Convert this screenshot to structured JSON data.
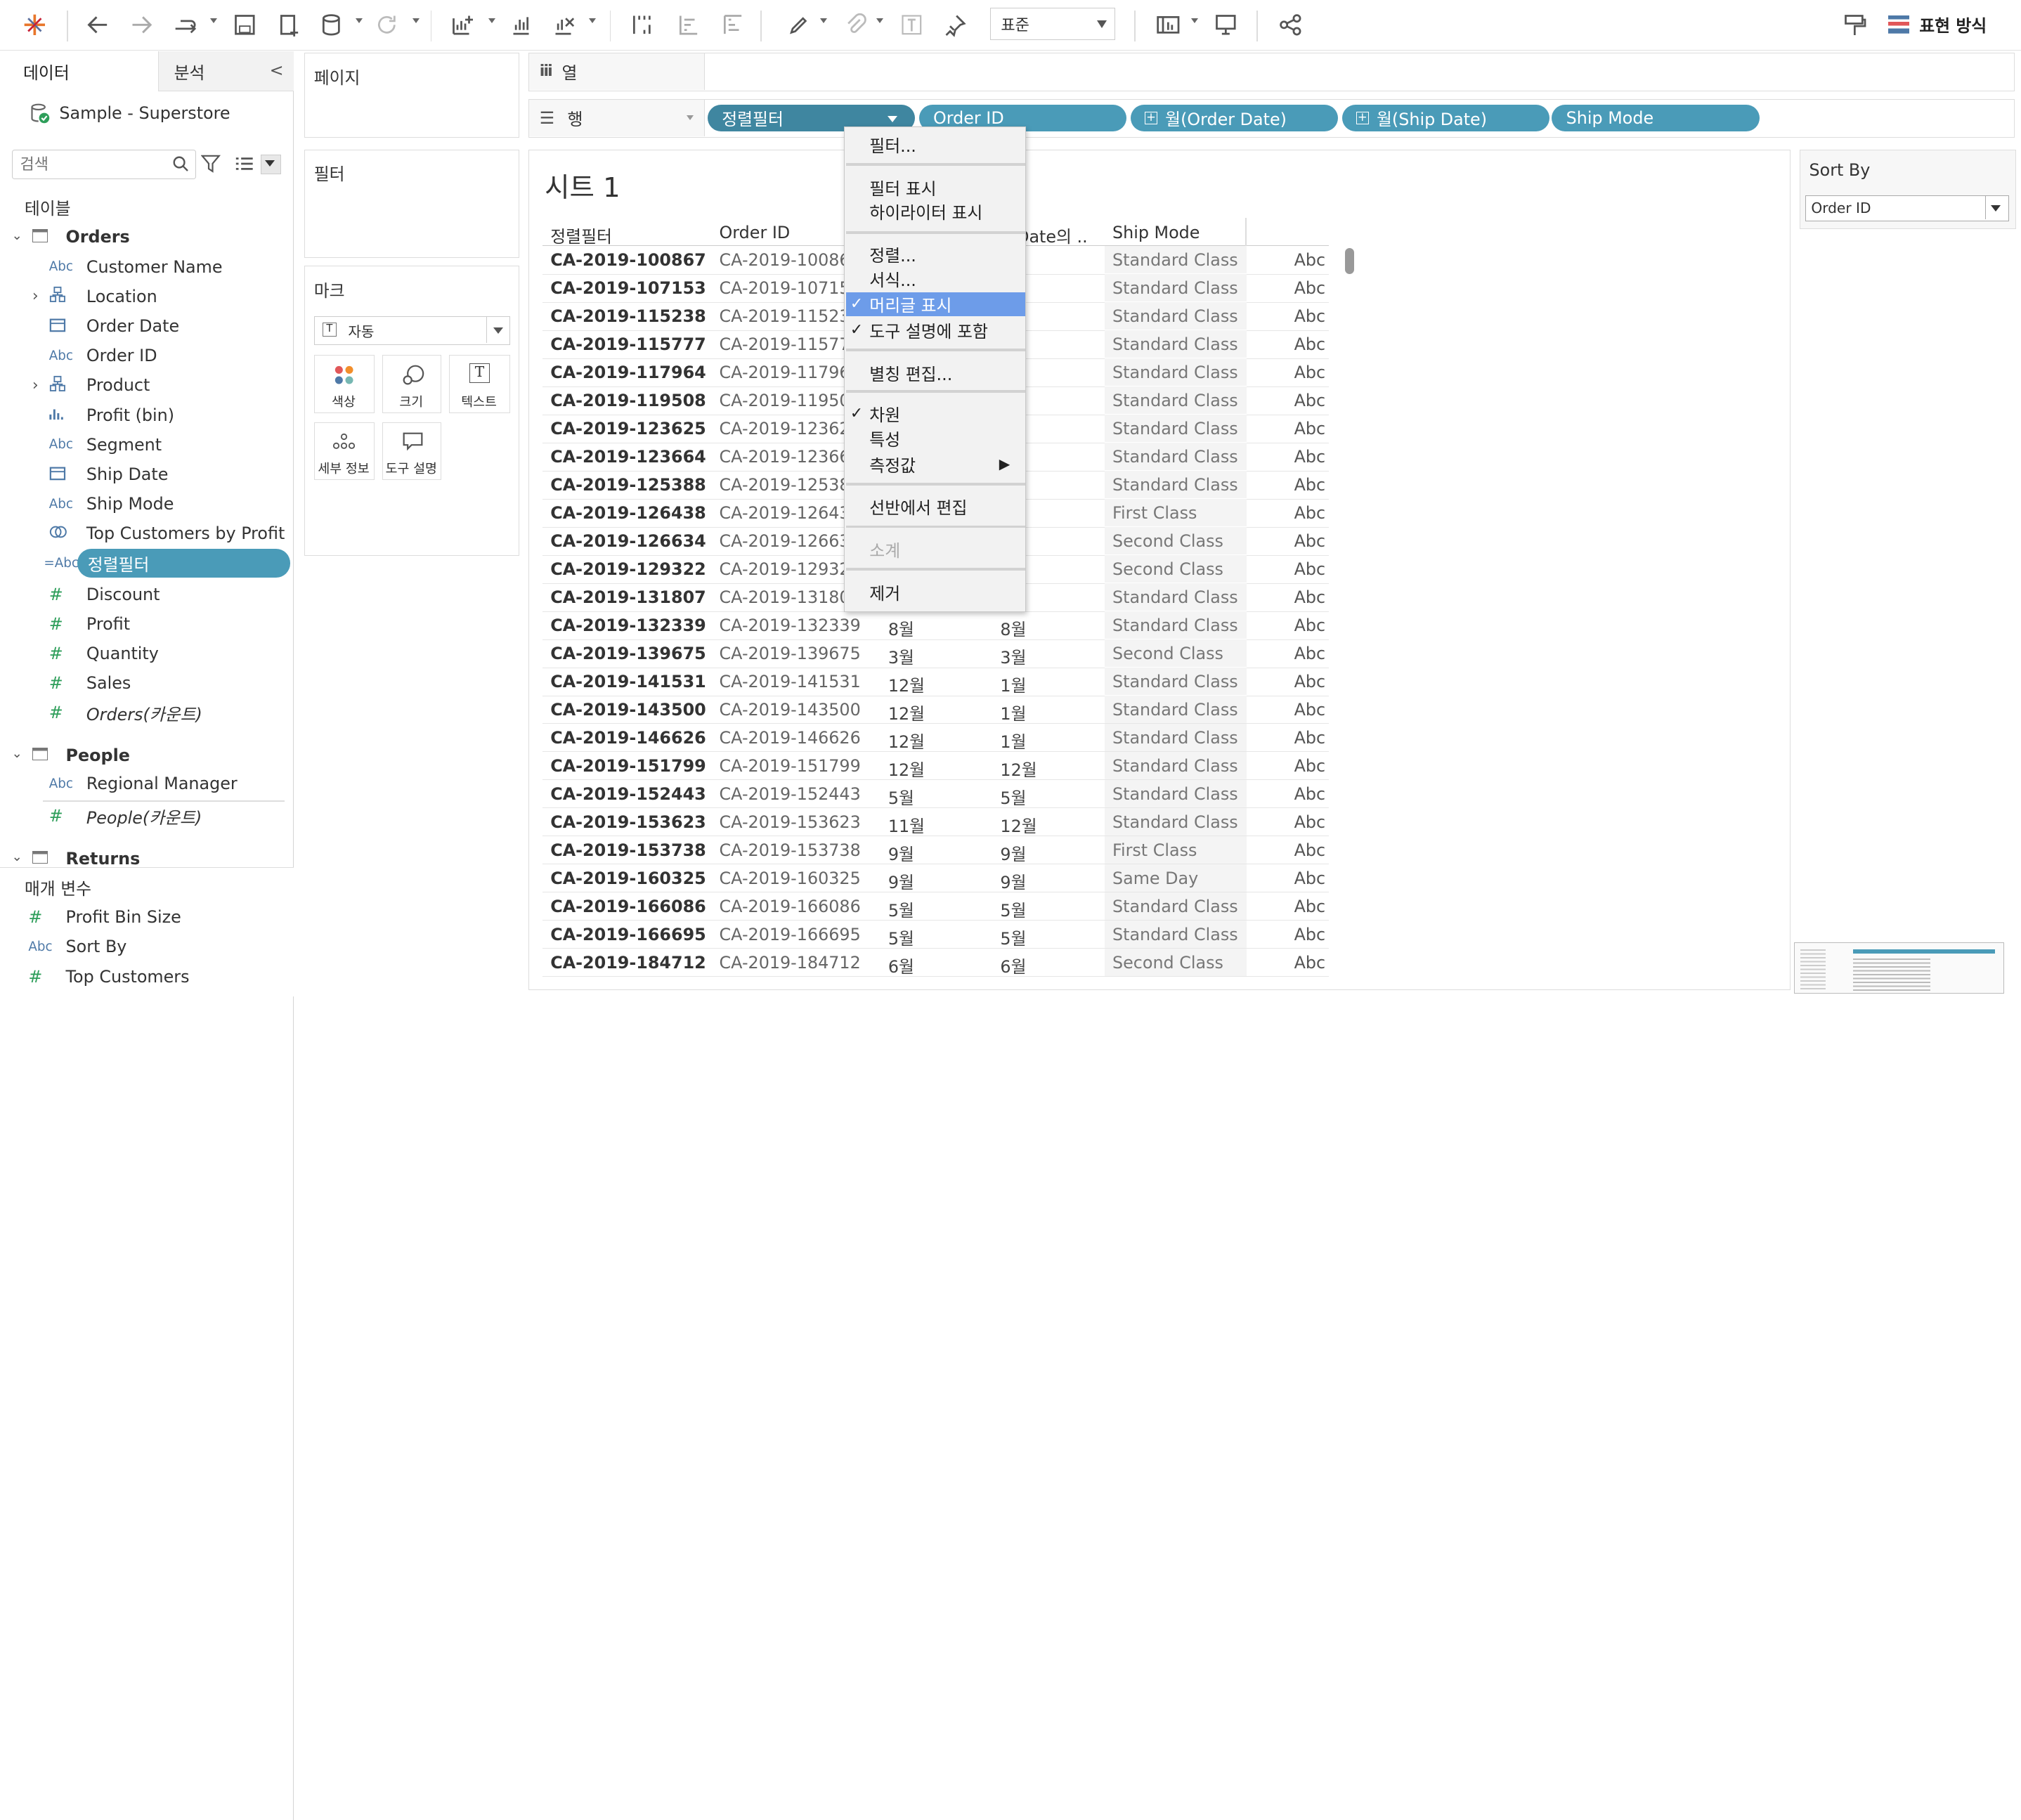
{
  "toolbar": {
    "view_mode": "표준",
    "show_me_label": "표현 방식"
  },
  "datapane": {
    "tab_data": "데이터",
    "tab_analytics": "분석",
    "datasource": "Sample - Superstore",
    "search_placeholder": "검색",
    "tables_header": "테이블",
    "orders_table": "Orders",
    "orders_fields": [
      {
        "type": "Abc",
        "name": "Customer Name"
      },
      {
        "type": "hier",
        "name": "Location"
      },
      {
        "type": "date",
        "name": "Order Date"
      },
      {
        "type": "Abc",
        "name": "Order ID"
      },
      {
        "type": "hier",
        "name": "Product"
      },
      {
        "type": "bin",
        "name": "Profit (bin)"
      },
      {
        "type": "Abc",
        "name": "Segment"
      },
      {
        "type": "date",
        "name": "Ship Date"
      },
      {
        "type": "Abc",
        "name": "Ship Mode"
      },
      {
        "type": "set",
        "name": "Top Customers by Profit"
      },
      {
        "type": "=Abc",
        "name": "정렬필터"
      },
      {
        "type": "#",
        "name": "Discount"
      },
      {
        "type": "#",
        "name": "Profit"
      },
      {
        "type": "#",
        "name": "Quantity"
      },
      {
        "type": "#",
        "name": "Sales"
      },
      {
        "type": "#",
        "name": "Orders(카운트)"
      }
    ],
    "people_table": "People",
    "people_fields": [
      {
        "type": "Abc",
        "name": "Regional Manager"
      },
      {
        "type": "#",
        "name": "People(카운트)"
      }
    ],
    "returns_table": "Returns",
    "params_header": "매개 변수",
    "params": [
      {
        "type": "#",
        "name": "Profit Bin Size"
      },
      {
        "type": "Abc",
        "name": "Sort By"
      },
      {
        "type": "#",
        "name": "Top Customers"
      }
    ]
  },
  "cards": {
    "pages": "페이지",
    "filters": "필터",
    "marks": "마크",
    "mark_type": "자동",
    "mark_buttons": [
      "색상",
      "크기",
      "텍스트",
      "세부 정보",
      "도구 설명"
    ]
  },
  "shelves": {
    "columns_label": "열",
    "rows_label": "행",
    "row_pills": [
      "정렬필터",
      "Order ID",
      "월(Order Date)",
      "월(Ship Date)",
      "Ship Mode"
    ]
  },
  "context_menu": {
    "items": [
      {
        "label": "필터...",
        "check": false
      },
      {
        "label": "필터 표시",
        "check": false
      },
      {
        "label": "하이라이터 표시",
        "check": false
      },
      {
        "label": "정렬...",
        "check": false
      },
      {
        "label": "서식...",
        "check": false
      },
      {
        "label": "머리글 표시",
        "check": true
      },
      {
        "label": "도구 설명에 포함",
        "check": true
      },
      {
        "label": "별칭 편집...",
        "check": false
      },
      {
        "label": "차원",
        "check": true
      },
      {
        "label": "특성",
        "check": false
      },
      {
        "label": "측정값",
        "check": false
      },
      {
        "label": "선반에서 편집",
        "check": false
      },
      {
        "label": "소계",
        "check": false
      },
      {
        "label": "제거",
        "check": false
      }
    ],
    "submenu_arrow": "▶"
  },
  "sheet": {
    "title": "시트 1",
    "headers": [
      "정렬필터",
      "Order ID",
      "p Date의 ..",
      "Ship Mode"
    ],
    "abc": "Abc",
    "rows": [
      [
        "CA-2019-100867",
        "CA-2019-10086",
        "",
        "월",
        "Standard Class"
      ],
      [
        "CA-2019-107153",
        "CA-2019-10715",
        "",
        "월",
        "Standard Class"
      ],
      [
        "CA-2019-115238",
        "CA-2019-11523",
        "",
        "",
        "Standard Class"
      ],
      [
        "CA-2019-115777",
        "CA-2019-11577",
        "",
        "",
        "Standard Class"
      ],
      [
        "CA-2019-117964",
        "CA-2019-11796",
        "",
        "월",
        "Standard Class"
      ],
      [
        "CA-2019-119508",
        "CA-2019-11950",
        "",
        "월",
        "Standard Class"
      ],
      [
        "CA-2019-123625",
        "CA-2019-12362",
        "",
        "",
        "Standard Class"
      ],
      [
        "CA-2019-123664",
        "CA-2019-12366",
        "",
        "월",
        "Standard Class"
      ],
      [
        "CA-2019-125388",
        "CA-2019-12538",
        "",
        "월",
        "Standard Class"
      ],
      [
        "CA-2019-126438",
        "CA-2019-12643",
        "",
        "",
        "First Class"
      ],
      [
        "CA-2019-126634",
        "CA-2019-12663",
        "",
        "월",
        "Second Class"
      ],
      [
        "CA-2019-129322",
        "CA-2019-12932",
        "",
        "",
        "Second Class"
      ],
      [
        "CA-2019-131807",
        "CA-2019-13180",
        "",
        "월",
        "Standard Class"
      ],
      [
        "CA-2019-132339",
        "CA-2019-132339",
        "8월",
        "8월",
        "Standard Class"
      ],
      [
        "CA-2019-139675",
        "CA-2019-139675",
        "3월",
        "3월",
        "Second Class"
      ],
      [
        "CA-2019-141531",
        "CA-2019-141531",
        "12월",
        "1월",
        "Standard Class"
      ],
      [
        "CA-2019-143500",
        "CA-2019-143500",
        "12월",
        "1월",
        "Standard Class"
      ],
      [
        "CA-2019-146626",
        "CA-2019-146626",
        "12월",
        "1월",
        "Standard Class"
      ],
      [
        "CA-2019-151799",
        "CA-2019-151799",
        "12월",
        "12월",
        "Standard Class"
      ],
      [
        "CA-2019-152443",
        "CA-2019-152443",
        "5월",
        "5월",
        "Standard Class"
      ],
      [
        "CA-2019-153623",
        "CA-2019-153623",
        "11월",
        "12월",
        "Standard Class"
      ],
      [
        "CA-2019-153738",
        "CA-2019-153738",
        "9월",
        "9월",
        "First Class"
      ],
      [
        "CA-2019-160325",
        "CA-2019-160325",
        "9월",
        "9월",
        "Same Day"
      ],
      [
        "CA-2019-166086",
        "CA-2019-166086",
        "5월",
        "5월",
        "Standard Class"
      ],
      [
        "CA-2019-166695",
        "CA-2019-166695",
        "5월",
        "5월",
        "Standard Class"
      ],
      [
        "CA-2019-184712",
        "CA-2019-184712",
        "6월",
        "6월",
        "Second Class"
      ]
    ]
  },
  "sort_by": {
    "title": "Sort By",
    "value": "Order ID"
  }
}
